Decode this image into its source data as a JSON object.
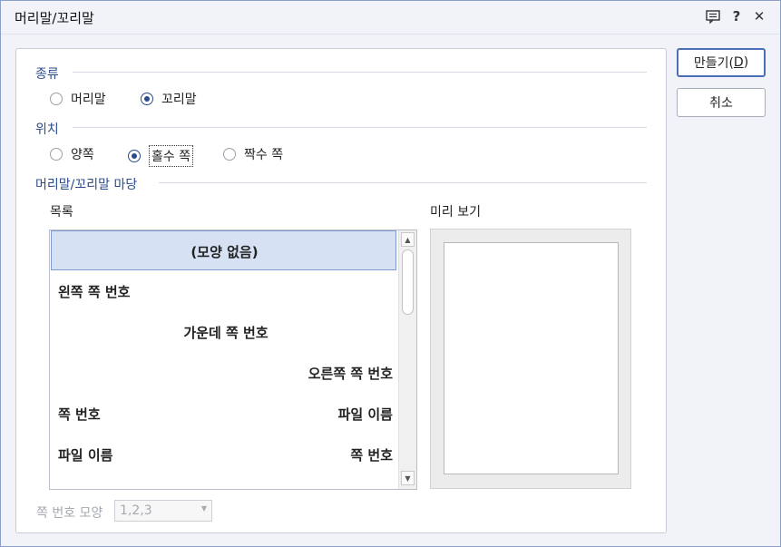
{
  "window": {
    "title": "머리말/꼬리말",
    "icons": [
      "comment-icon",
      "help-icon",
      "close-icon"
    ],
    "help_glyph": "?",
    "close_glyph": "✕"
  },
  "kind": {
    "label": "종류",
    "options": [
      {
        "label": "머리말",
        "selected": false
      },
      {
        "label": "꼬리말",
        "selected": true
      }
    ]
  },
  "position": {
    "label": "위치",
    "options": [
      {
        "label": "양쪽",
        "selected": false
      },
      {
        "label": "홀수 쪽",
        "selected": true
      },
      {
        "label": "짝수 쪽",
        "selected": false
      }
    ]
  },
  "gallery": {
    "label": "머리말/꼬리말 마당",
    "list_label": "목록",
    "preview_label": "미리 보기",
    "items": [
      {
        "left": "",
        "center": "(모양 없음)",
        "right": "",
        "selected": true
      },
      {
        "left": "왼쪽 쪽 번호",
        "center": "",
        "right": "",
        "selected": false
      },
      {
        "left": "",
        "center": "가운데 쪽 번호",
        "right": "",
        "selected": false
      },
      {
        "left": "",
        "center": "",
        "right": "오른쪽 쪽 번호",
        "selected": false
      },
      {
        "left": "쪽 번호",
        "center": "",
        "right": "파일 이름",
        "selected": false
      },
      {
        "left": "파일 이름",
        "center": "",
        "right": "쪽 번호",
        "selected": false
      }
    ]
  },
  "number_format": {
    "label": "쪽 번호 모양",
    "value": "1,2,3"
  },
  "buttons": {
    "create_label": "만들기(",
    "create_mnemonic": "D",
    "create_suffix": ")",
    "cancel_label": "취소"
  },
  "colors": {
    "accent": "#2a4b8c",
    "selection_bg": "#d7e1f4",
    "primary_border": "#4a6fb8"
  }
}
